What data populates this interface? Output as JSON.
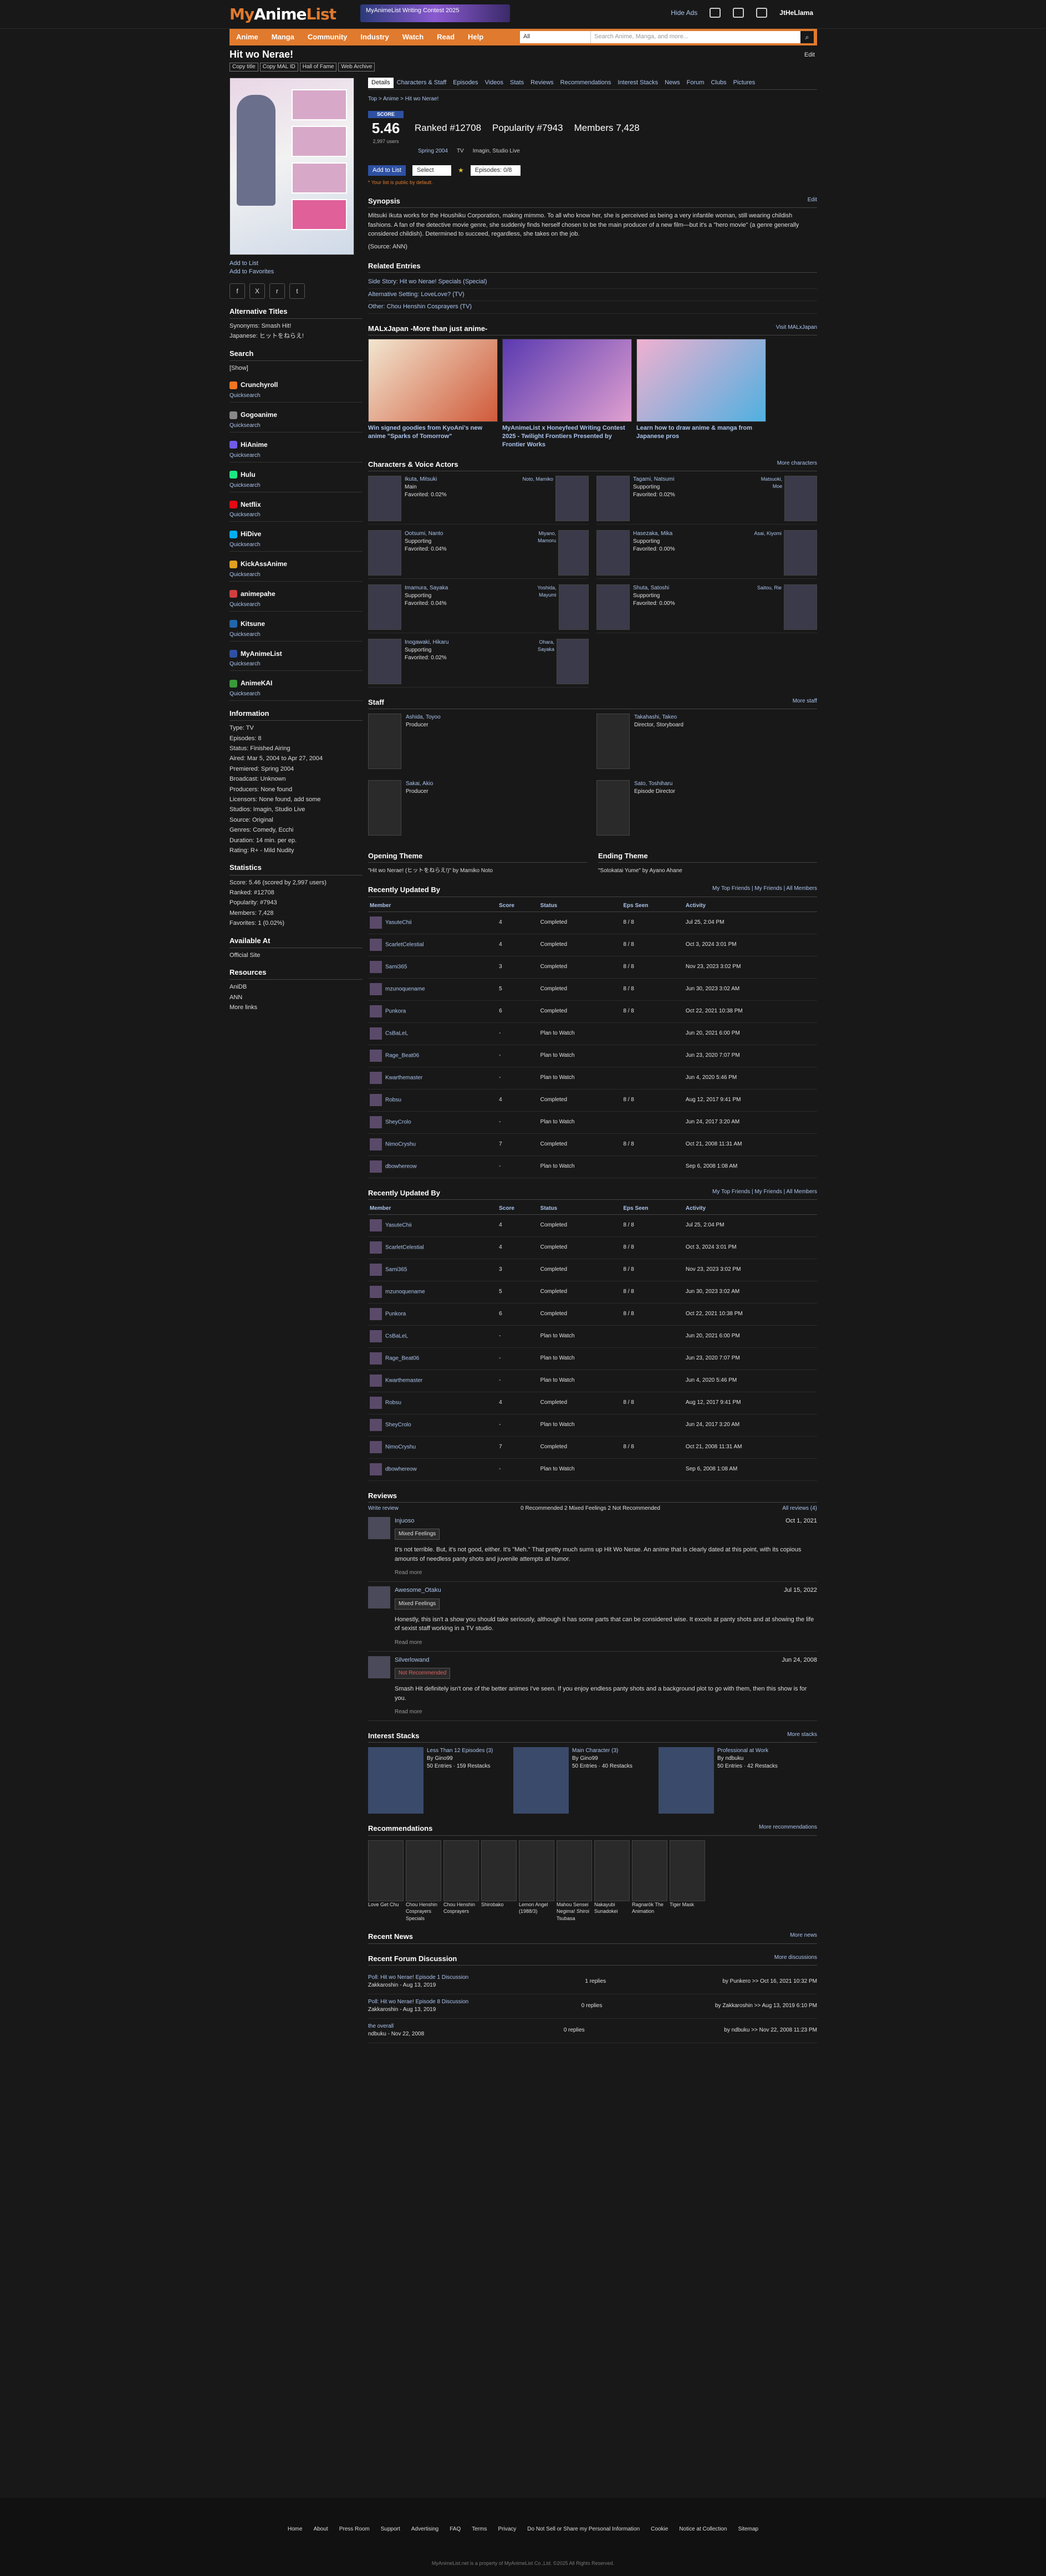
{
  "header": {
    "logo_a": "My",
    "logo_b": "Anime",
    "logo_c": "List",
    "banner": "MyAnimeList Writing Contest 2025",
    "hide_ads": "Hide Ads",
    "user": "JtHeLlama"
  },
  "menu": [
    "Anime",
    "Manga",
    "Community",
    "Industry",
    "Watch",
    "Read",
    "Help"
  ],
  "search": {
    "category": "All",
    "placeholder": "Search Anime, Manga, and more..."
  },
  "title": {
    "name": "Hit wo Nerae!",
    "btn1": "Copy title",
    "btn2": "Copy MAL ID",
    "btn3": "Hall of Fame",
    "btn4": "Web Archive",
    "edit": "Edit"
  },
  "left": {
    "add_list": "Add to List",
    "add_fav": "Add to Favorites",
    "alt_title": "Alternative Titles",
    "synonyms": "Synonyms: Smash Hit!",
    "japanese": "Japanese: ヒットをねらえ!",
    "search": "Search",
    "show": "[Show]",
    "streams": [
      {
        "name": "Crunchyroll",
        "color": "#f47521"
      },
      {
        "name": "Gogoanime",
        "color": "#888"
      },
      {
        "name": "HiAnime",
        "color": "#6f5be8"
      },
      {
        "name": "Hulu",
        "color": "#1ce783"
      },
      {
        "name": "Netflix",
        "color": "#e50914"
      },
      {
        "name": "HiDive",
        "color": "#00aeef"
      },
      {
        "name": "KickAssAnime",
        "color": "#e0a020"
      },
      {
        "name": "animepahe",
        "color": "#d04040"
      },
      {
        "name": "Kitsune",
        "color": "#2266aa"
      },
      {
        "name": "MyAnimeList",
        "color": "#2e51a2"
      },
      {
        "name": "AnimeKAI",
        "color": "#3a9a3a"
      }
    ],
    "quicksearch": "Quicksearch",
    "info_title": "Information",
    "info": [
      "Type: TV",
      "Episodes: 8",
      "Status: Finished Airing",
      "Aired: Mar 5, 2004 to Apr 27, 2004",
      "Premiered: Spring 2004",
      "Broadcast: Unknown",
      "Producers: None found",
      "Licensors: None found, add some",
      "Studios: Imagin, Studio Live",
      "Source: Original",
      "Genres: Comedy, Ecchi",
      "Duration: 14 min. per ep.",
      "Rating: R+ - Mild Nudity"
    ],
    "stats_title": "Statistics",
    "stats": [
      "Score: 5.46 (scored by 2,997 users)",
      "Ranked: #12708",
      "Popularity: #7943",
      "Members: 7,428",
      "Favorites: 1 (0.02%)"
    ],
    "avail_title": "Available At",
    "official": "Official Site",
    "res_title": "Resources",
    "res": [
      "AniDB",
      "ANN"
    ],
    "more_links": "More links"
  },
  "main": {
    "tabs": [
      "Details",
      "Characters & Staff",
      "Episodes",
      "Videos",
      "Stats",
      "Reviews",
      "Recommendations",
      "Interest Stacks",
      "News",
      "Forum",
      "Clubs",
      "Pictures"
    ],
    "breadcrumb": "Top > Anime > Hit wo Nerae!",
    "score_label": "SCORE",
    "score": "5.46",
    "score_users": "2,997 users",
    "ranked": "Ranked #12708",
    "popularity": "Popularity #7943",
    "members": "Members 7,428",
    "season": "Spring 2004",
    "type": "TV",
    "studios": "Imagin, Studio Live",
    "add_list": "Add to List",
    "select": "Select",
    "episodes": "Episodes: 0/8",
    "private": "* Your list is public by default.",
    "syn_title": "Synopsis",
    "syn_edit": "Edit",
    "synopsis": "Mitsuki Ikuta works for the Houshiku Corporation, making mimmo. To all who know her, she is perceived as being a very infantile woman, still wearing childish fashions. A fan of the detective movie genre, she suddenly finds herself chosen to be the main producer of a new film—but it's a \"hero movie\" (a genre generally considered childish). Determined to succeed, regardless, she takes on the job.",
    "source": "(Source: ANN)",
    "rel_title": "Related Entries",
    "rel": [
      "Side Story: Hit wo Nerae! Specials (Special)",
      "Alternative Setting: LoveLove? (TV)",
      "Other: Chou Henshin Cosprayers (TV)"
    ],
    "promo_title": "MALxJapan -More than just anime-",
    "promo_more": "Visit MALxJapan",
    "promos": [
      "Win signed goodies from KyoAni's new anime \"Sparks of Tomorrow\"",
      "MyAnimeList x Honeyfeed Writing Contest 2025 - Twilight Frontiers Presented by Frontier Works",
      "Learn how to draw anime & manga from Japanese pros"
    ],
    "chars_title": "Characters & Voice Actors",
    "chars_more": "More characters",
    "chars": [
      {
        "name": "Ikuta, Mitsuki",
        "role": "Main",
        "fav": "Favorited: 0.02%",
        "va": "Noto, Mamiko"
      },
      {
        "name": "Tagami, Natsumi",
        "role": "Supporting",
        "fav": "Favorited: 0.02%",
        "va": "Matsuoki, Moe"
      },
      {
        "name": "Ootsumi, Nanto",
        "role": "Supporting",
        "fav": "Favorited: 0.04%",
        "va": "Miyano, Mamoru"
      },
      {
        "name": "Hasezaka, Mika",
        "role": "Supporting",
        "fav": "Favorited: 0.00%",
        "va": "Asai, Kiyomi"
      },
      {
        "name": "Imamura, Sayaka",
        "role": "Supporting",
        "fav": "Favorited: 0.04%",
        "va": "Yoshida, Mayumi"
      },
      {
        "name": "Shuta, Satoshi",
        "role": "Supporting",
        "fav": "Favorited: 0.00%",
        "va": "Saitou, Rie"
      },
      {
        "name": "Inogawaki, Hikaru",
        "role": "Supporting",
        "fav": "Favorited: 0.02%",
        "va": "Ohara, Sayaka"
      }
    ],
    "staff_title": "Staff",
    "staff_more": "More staff",
    "staff": [
      {
        "name": "Ashida, Toyoo",
        "role": "Producer"
      },
      {
        "name": "Takahashi, Takeo",
        "role": "Director, Storyboard"
      },
      {
        "name": "Sakai, Akio",
        "role": "Producer"
      },
      {
        "name": "Sato, Toshiharu",
        "role": "Episode Director"
      }
    ],
    "op_title": "Opening Theme",
    "ed_title": "Ending Theme",
    "op": "\"Hit wo Nerae! (ヒットをねらえ!)\" by Mamiko Noto",
    "ed": "\"Sotokatai Yume\" by Ayano Ahane",
    "upd_title": "Recently Updated By",
    "upd_filter": "My Top Friends | My Friends | All Members",
    "upd_head": [
      "Member",
      "Score",
      "Status",
      "Eps Seen",
      "Activity"
    ],
    "updates": [
      [
        "YasuteChii",
        "4",
        "Completed",
        "8 / 8",
        "Jul 25, 2:04 PM"
      ],
      [
        "ScarletCelestial",
        "4",
        "Completed",
        "8 / 8",
        "Oct 3, 2024 3:01 PM"
      ],
      [
        "Sami365",
        "3",
        "Completed",
        "8 / 8",
        "Nov 23, 2023 3:02 PM"
      ],
      [
        "mzunoquename",
        "5",
        "Completed",
        "8 / 8",
        "Jun 30, 2023 3:02 AM"
      ],
      [
        "Punkora",
        "6",
        "Completed",
        "8 / 8",
        "Oct 22, 2021 10:38 PM"
      ],
      [
        "CsBaLeL",
        "-",
        "Plan to Watch",
        "",
        "Jun 20, 2021 6:00 PM"
      ],
      [
        "Rage_Beat06",
        "-",
        "Plan to Watch",
        "",
        "Jun 23, 2020 7:07 PM"
      ],
      [
        "Kwarthemaster",
        "-",
        "Plan to Watch",
        "",
        "Jun 4, 2020 5:46 PM"
      ],
      [
        "Robsu",
        "4",
        "Completed",
        "8 / 8",
        "Aug 12, 2017 9:41 PM"
      ],
      [
        "SheyCrolo",
        "-",
        "Plan to Watch",
        "",
        "Jun 24, 2017 3:20 AM"
      ],
      [
        "NimoCryshu",
        "7",
        "Completed",
        "8 / 8",
        "Oct 21, 2008 11:31 AM"
      ],
      [
        "dbowhereow",
        "-",
        "Plan to Watch",
        "",
        "Sep 6, 2008 1:08 AM"
      ]
    ],
    "rev_title": "Reviews",
    "rev_write": "Write review",
    "rev_tabs": "0 Recommended   2 Mixed Feelings   2 Not Recommended",
    "rev_all": "All reviews (4)",
    "reviews": [
      {
        "user": "Injuoso",
        "date": "Oct 1, 2021",
        "tag": "Mixed Feelings",
        "text": "It's not terrible. But, it's not good, either. It's \"Meh.\" That pretty much sums up Hit Wo Nerae. An anime that is clearly dated at this point, with its copious amounts of needless panty shots and juvenile attempts at humor.",
        "act": "Read more"
      },
      {
        "user": "Awesome_Otaku",
        "date": "Jul 15, 2022",
        "tag": "Mixed Feelings",
        "text": "Honestly, this isn't a show you should take seriously, although it has some parts that can be considered wise. It excels at panty shots and at showing the life of sexist staff working in a TV studio.",
        "act": "Read more"
      },
      {
        "user": "Silverlowand",
        "date": "Jun 24, 2008",
        "tag": "Not Recommended",
        "text": "Smash Hit definitely isn't one of the better animes I've seen. If you enjoy endless panty shots and a background plot to go with them, then this show is for you.",
        "act": "Read more"
      }
    ],
    "stacks_title": "Interest Stacks",
    "stacks_more": "More stacks",
    "stacks": [
      {
        "name": "Less Than 12 Episodes (3)",
        "by": "By Gino99",
        "n": "50 Entries · 159 Restacks"
      },
      {
        "name": "Main Character (3)",
        "by": "By Gino99",
        "n": "50 Entries · 40 Restacks"
      },
      {
        "name": "Professional at Work",
        "by": "By ndbuku",
        "n": "50 Entries · 42 Restacks"
      }
    ],
    "recs_title": "Recommendations",
    "recs_more": "More recommendations",
    "recs": [
      "Love Get Chu",
      "Chou Henshin Cosprayers Specials",
      "Chou Henshin Cosprayers",
      "Shirobako",
      "Lemon Angel (1988/3)",
      "Mahou Sensei Negima! Shiroi Tsubasa",
      "Nakayubi Sunadokei",
      "Ragnarök The Animation",
      "Tiger Mask"
    ],
    "news_title": "Recent News",
    "news_more": "More news",
    "disc_title": "Recent Forum Discussion",
    "disc_more": "More discussions",
    "disc": [
      {
        "t": "Poll: Hit wo Nerae! Episode 1 Discussion",
        "by": "Zakkaroshin - Aug 13, 2019",
        "r": "1 replies",
        "last": "by Punkero >> Oct 16, 2021 10:32 PM"
      },
      {
        "t": "Poll: Hit wo Nerae! Episode 8 Discussion",
        "by": "Zakkaroshin - Aug 13, 2019",
        "r": "0 replies",
        "last": "by Zakkaroshin >> Aug 13, 2019 6:10 PM"
      },
      {
        "t": "the overall",
        "by": "ndbuku - Nov 22, 2008",
        "r": "0 replies",
        "last": "by ndbuku >> Nov 22, 2008 11:23 PM"
      }
    ]
  },
  "footer": {
    "links": [
      "Home",
      "About",
      "Press Room",
      "Support",
      "Advertising",
      "FAQ",
      "Terms",
      "Privacy",
      "Do Not Sell or Share my Personal Information",
      "Cookie",
      "Notice at Collection",
      "Sitemap"
    ],
    "copy": "MyAnimeList.net is a property of MyAnimeList Co.,Ltd. ©2025 All Rights Reserved."
  }
}
